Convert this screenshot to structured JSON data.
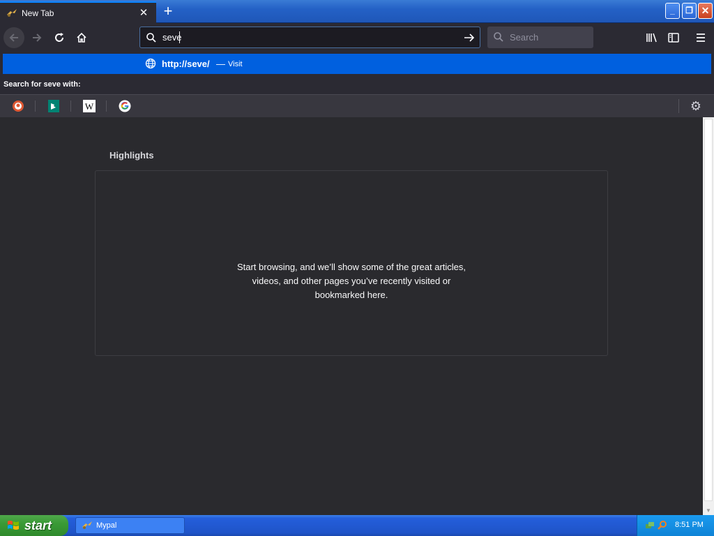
{
  "browser": {
    "tab": {
      "title": "New Tab"
    },
    "urlbar": {
      "value": "seve"
    },
    "searchbar": {
      "placeholder": "Search"
    }
  },
  "dropdown": {
    "suggestion": {
      "url": "http://seve/",
      "separator": "—",
      "action": "Visit"
    },
    "search_with_label": "Search for seve with:",
    "engines": [
      "duckduckgo-icon",
      "bing-icon",
      "wikipedia-icon",
      "google-icon"
    ]
  },
  "content": {
    "highlights_title": "Highlights",
    "highlights_message": "Start browsing, and we’ll show some of the great articles, videos, and other pages you’ve recently visited or bookmarked here."
  },
  "taskbar": {
    "start_label": "start",
    "task_item": "Mypal",
    "clock": "8:51 PM"
  },
  "colors": {
    "accent": "#0060df",
    "toolbar": "#2b2a33",
    "content_bg": "#2a2a2e",
    "xp_taskbar": "#245edb",
    "xp_start": "#3a9a36"
  }
}
